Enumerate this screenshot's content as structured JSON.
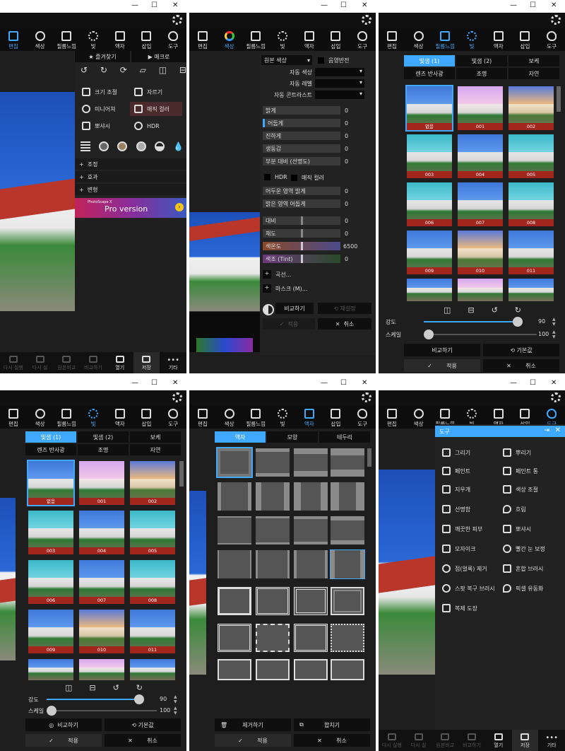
{
  "window_buttons": [
    "—",
    "☐",
    "✕"
  ],
  "tabs_edit": [
    "편집",
    "색상",
    "필름느낌",
    "빛",
    "액자",
    "삽입",
    "도구"
  ],
  "p1": {
    "favorites": "즐겨찾기",
    "macro": "매크로",
    "tools": [
      "크기 조절",
      "자르기",
      "미니어쳐",
      "매직 컬러",
      "뽀샤시",
      "HDR"
    ],
    "sections": [
      "조정",
      "효과",
      "변형"
    ],
    "banner": "Pro version",
    "banner_prefix": "PhotoScape X"
  },
  "p2": {
    "dropdown": "원본 색상",
    "shadow_check": "음영반전",
    "autos": [
      "자동 색상",
      "자동 레벨",
      "자동 콘트라스트"
    ],
    "sliders1": [
      {
        "label": "밝게",
        "value": "0"
      },
      {
        "label": "어둡게",
        "value": "0"
      },
      {
        "label": "진하게",
        "value": "0"
      },
      {
        "label": "생동감",
        "value": "0"
      },
      {
        "label": "부분 대비 (선명도)",
        "value": "0"
      }
    ],
    "hdr": "HDR",
    "magic": "매직 컬러",
    "sliders2": [
      {
        "label": "어두운 영역 밝게",
        "value": "0"
      },
      {
        "label": "밝은 영역 어둡게",
        "value": "0"
      }
    ],
    "sliders3": [
      {
        "label": "대비",
        "value": "0"
      },
      {
        "label": "채도",
        "value": "0"
      },
      {
        "label": "색온도",
        "value": "6500"
      },
      {
        "label": "색조 (Tint)",
        "value": "0"
      }
    ],
    "curves": "곡선...",
    "mask": "마스크 (M)...",
    "compare": "비교하기",
    "reset": "재설정",
    "apply": "적용",
    "cancel": "취소"
  },
  "filter": {
    "tabs_row1": [
      "빛샘 (1)",
      "빛샘 (2)",
      "보케"
    ],
    "tabs_row2": [
      "렌즈 반사광",
      "조명",
      "자연"
    ],
    "thumbs": [
      "없음",
      "001",
      "002",
      "003",
      "004",
      "005",
      "006",
      "007",
      "008",
      "009",
      "010",
      "011"
    ],
    "strength_label": "강도",
    "strength_value": "90",
    "scale_label": "스케일",
    "scale_value": "100",
    "compare": "비교하기",
    "default": "기본값",
    "apply": "적용",
    "cancel": "취소"
  },
  "frame": {
    "tabs": [
      "액자",
      "모양",
      "테두리"
    ],
    "remove": "제거하기",
    "merge": "합치기",
    "apply": "적용",
    "cancel": "취소"
  },
  "toolsmenu": {
    "title": "도구",
    "items": [
      "그리기",
      "뿌리기",
      "페인트",
      "페인트 통",
      "지우개",
      "색상 조절",
      "선명함",
      "흐림",
      "깨끗한 피부",
      "뽀샤시",
      "모자이크",
      "빨간 눈 보정",
      "점(얼룩) 제거",
      "혼합 브러시",
      "스팟 복구 브러시",
      "픽셀 유동화",
      "복제 도장"
    ]
  },
  "bottom": [
    "다시 실행",
    "다시 실",
    "원본비교",
    "비교하기",
    "열기",
    "저장",
    "기타"
  ],
  "colors": {
    "accent": "#3fa9ff",
    "bg": "#1e1e1e"
  }
}
